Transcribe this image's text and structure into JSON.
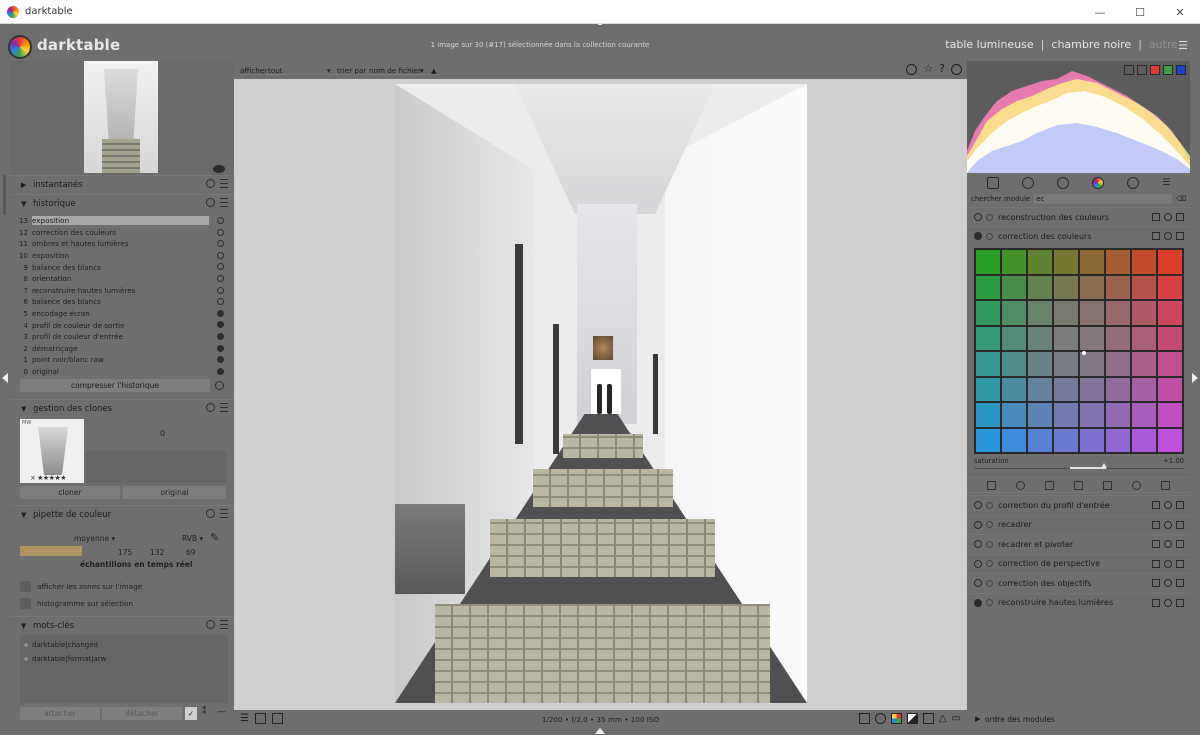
{
  "window": {
    "title": "darktable",
    "controls": [
      "—",
      "☐",
      "✕"
    ]
  },
  "header": {
    "logo_text": "darktable",
    "status": "1 image sur 30 (#17) sélectionnée dans la collection courante",
    "views": [
      "table lumineuse",
      "chambre noire",
      "autre"
    ],
    "views_menu": "☰"
  },
  "left": {
    "snapshots_title": "instantanés",
    "history_title": "historique",
    "history_items": [
      {
        "num": "13",
        "label": "exposition",
        "active": true,
        "solid": false
      },
      {
        "num": "12",
        "label": "correction des couleurs",
        "active": false,
        "solid": false
      },
      {
        "num": "11",
        "label": "ombres et hautes lumières",
        "active": false,
        "solid": false
      },
      {
        "num": "10",
        "label": "exposition",
        "active": false,
        "solid": false
      },
      {
        "num": "9",
        "label": "balance des blancs",
        "active": false,
        "solid": false
      },
      {
        "num": "8",
        "label": "orientation",
        "active": false,
        "solid": false
      },
      {
        "num": "7",
        "label": "reconstruire hautes lumières",
        "active": false,
        "solid": false
      },
      {
        "num": "6",
        "label": "balance des blancs",
        "active": false,
        "solid": false
      },
      {
        "num": "5",
        "label": "encodage écran",
        "active": false,
        "solid": true
      },
      {
        "num": "4",
        "label": "profil de couleur de sortie",
        "active": false,
        "solid": true
      },
      {
        "num": "3",
        "label": "profil de couleur d'entrée",
        "active": false,
        "solid": true
      },
      {
        "num": "2",
        "label": "dématriçage",
        "active": false,
        "solid": true
      },
      {
        "num": "1",
        "label": "point noir/blanc raw",
        "active": false,
        "solid": true
      },
      {
        "num": "0",
        "label": "original",
        "active": false,
        "solid": true
      }
    ],
    "compress_label": "compresser l'historique",
    "clones_title": "gestion des clones",
    "clone_count": "0",
    "clone_thumb_tag": "MW",
    "clone_stars": "× ★★★★★",
    "clone_btn": "cloner",
    "original_btn": "original",
    "picker_title": "pipette de couleur",
    "picker_mode": "moyenne",
    "picker_space": "RVB",
    "picker_values": [
      "175",
      "132",
      "69"
    ],
    "picker_live": "échantillons en temps réel",
    "picker_color": "#af9360",
    "check_zones": "afficher les zones sur l'image",
    "check_histo": "histogramme sur sélection",
    "tags_title": "mots-clés",
    "tags": [
      "darktable|changed",
      "darktable|format|arw"
    ],
    "attach_btn": "attacher",
    "detach_btn": "détacher"
  },
  "center": {
    "show_label": "afficher",
    "show_value": "tout",
    "sort_label": "trier par",
    "sort_value": "nom de fichier",
    "exif": "1/200 • f/2,0 • 35 mm • 100 ISO"
  },
  "right": {
    "search_label": "chercher module",
    "search_value": "ec",
    "modules_top": [
      {
        "name": "reconstruction des couleurs",
        "on": false
      },
      {
        "name": "correction des couleurs",
        "on": true
      }
    ],
    "saturation_label": "saturation",
    "saturation_value": "+1.00",
    "modules_bottom": [
      {
        "name": "correction du profil d'entrée",
        "on": false
      },
      {
        "name": "recadrer",
        "on": false
      },
      {
        "name": "recadrer et pivoter",
        "on": false
      },
      {
        "name": "correction de perspective",
        "on": false
      },
      {
        "name": "correction des objectifs",
        "on": false
      },
      {
        "name": "reconstruire hautes lumières",
        "on": true
      }
    ],
    "module_order_label": "ordre des modules"
  }
}
